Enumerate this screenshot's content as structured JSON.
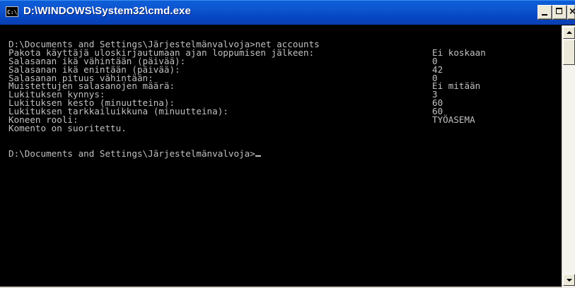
{
  "window": {
    "title": "D:\\WINDOWS\\System32\\cmd.exe",
    "icon_label": "C:\\",
    "controls": {
      "minimize": "minimize-icon",
      "maximize": "maximize-icon",
      "close": "close-icon"
    },
    "colors": {
      "titlebar": "#0a56d0",
      "console_bg": "#000000",
      "console_text": "#c0c0c0"
    }
  },
  "console": {
    "command_line": "D:\\Documents and Settings\\Järjestelmänvalvoja>net accounts",
    "rows": [
      {
        "label": "Pakota käyttäjä uloskirjautumaan ajan loppumisen jälkeen:",
        "value": "Ei koskaan"
      },
      {
        "label": "Salasanan ikä vähintään (päivää):",
        "value": "0"
      },
      {
        "label": "Salasanan ikä enintään (päivää):",
        "value": "42"
      },
      {
        "label": "Salasanan pituus vähintään:",
        "value": "0"
      },
      {
        "label": "Muistettujen salasanojen määrä:",
        "value": "Ei mitään"
      },
      {
        "label": "Lukituksen kynnys:",
        "value": "3"
      },
      {
        "label": "Lukituksen kesto (minuutteina):",
        "value": "60"
      },
      {
        "label": "Lukituksen tarkkailuikkuna (minuutteina):",
        "value": "60"
      },
      {
        "label": "Koneen rooli:",
        "value": "TYÖASEMA"
      }
    ],
    "completion_message": "Komento on suoritettu.",
    "prompt": "D:\\Documents and Settings\\Järjestelmänvalvoja>"
  }
}
